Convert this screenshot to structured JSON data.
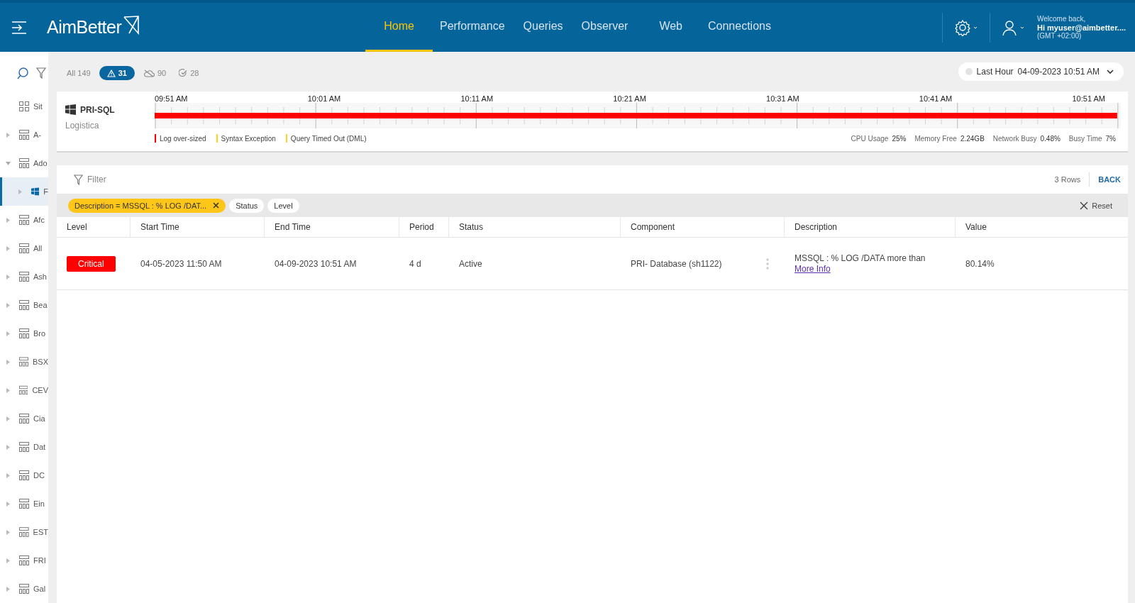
{
  "header": {
    "logo": "AimBetter",
    "nav": [
      {
        "label": "Home",
        "selected": true
      },
      {
        "label": "Performance",
        "selected": false
      },
      {
        "label": "Queries",
        "selected": false
      },
      {
        "label": "Observer",
        "selected": false
      },
      {
        "label": "Web",
        "selected": false
      },
      {
        "label": "Connections",
        "selected": false
      }
    ],
    "user": {
      "greeting": "Welcome back,",
      "name": "Hi myuser@aimbetter....",
      "timezone": "(GMT +02:00)"
    }
  },
  "sidebar": {
    "items": [
      {
        "kind": "overview",
        "label": "Sit",
        "selected": false
      },
      {
        "kind": "group",
        "label": "A-",
        "expanded": false,
        "selected": false
      },
      {
        "kind": "group",
        "label": "Ado",
        "expanded": true,
        "selected": false,
        "children": [
          {
            "kind": "server",
            "label": "F",
            "expanded": false,
            "selected": true
          }
        ]
      },
      {
        "kind": "group",
        "label": "Afc",
        "expanded": false,
        "selected": false
      },
      {
        "kind": "group",
        "label": "All",
        "expanded": false,
        "selected": false
      },
      {
        "kind": "group",
        "label": "Ash",
        "expanded": false,
        "selected": false
      },
      {
        "kind": "group",
        "label": "Bea",
        "expanded": false,
        "selected": false
      },
      {
        "kind": "group",
        "label": "Bro",
        "expanded": false,
        "selected": false
      },
      {
        "kind": "group",
        "label": "BSX",
        "expanded": false,
        "selected": false
      },
      {
        "kind": "group",
        "label": "CEV",
        "expanded": false,
        "selected": false
      },
      {
        "kind": "group",
        "label": "Cia",
        "expanded": false,
        "selected": false
      },
      {
        "kind": "group",
        "label": "Dat",
        "expanded": false,
        "selected": false
      },
      {
        "kind": "group",
        "label": "DC",
        "expanded": false,
        "selected": false
      },
      {
        "kind": "group",
        "label": "Ein",
        "expanded": false,
        "selected": false
      },
      {
        "kind": "group",
        "label": "EST",
        "expanded": false,
        "selected": false
      },
      {
        "kind": "group",
        "label": "FRI",
        "expanded": false,
        "selected": false
      },
      {
        "kind": "group",
        "label": "Gal",
        "expanded": false,
        "selected": false
      }
    ]
  },
  "status_filters": [
    {
      "kind": "all",
      "label": "All 149",
      "selected": false
    },
    {
      "kind": "alert",
      "label": "31",
      "selected": true
    },
    {
      "kind": "cloud",
      "label": "90",
      "selected": false
    },
    {
      "kind": "check",
      "label": "28",
      "selected": false
    }
  ],
  "time_range": {
    "period": "Last Hour",
    "date": "04-09-2023 10:51 AM"
  },
  "timeline": {
    "server": "PRI-SQL",
    "customer": "Logistica",
    "times": [
      "09:51 AM",
      "10:01 AM",
      "10:11 AM",
      "10:21 AM",
      "10:31 AM",
      "10:41 AM",
      "10:51 AM"
    ],
    "legend": [
      {
        "label": "Log over-sized",
        "color": "#ff0000"
      },
      {
        "label": "Syntax Exception",
        "color": "#ffd21f"
      },
      {
        "label": "Query Timed Out (DML)",
        "color": "#ffd21f"
      }
    ],
    "stats": [
      {
        "label": "CPU Usage",
        "value": "25%"
      },
      {
        "label": "Memory Free",
        "value": "2.24GB"
      },
      {
        "label": "Network Busy",
        "value": "0.48%"
      },
      {
        "label": "Busy Time",
        "value": "7%"
      }
    ]
  },
  "panel": {
    "filter_label": "Filter",
    "rows": "3 Rows",
    "back": "BACK",
    "reset": "Reset",
    "chips": [
      {
        "label": "Description = MSSQL : % LOG /DAT...",
        "active": true
      },
      {
        "label": "Status",
        "active": false
      },
      {
        "label": "Level",
        "active": false
      }
    ]
  },
  "table": {
    "columns": [
      "Level",
      "Start Time",
      "End Time",
      "Period",
      "Status",
      "Component",
      "Description",
      "Value"
    ],
    "rows": [
      {
        "level": "Critical",
        "start": "04-05-2023 11:50 AM",
        "end": "04-09-2023 10:51 AM",
        "period": "4 d",
        "status": "Active",
        "component": "PRI- Database (sh1122)",
        "description": "MSSQL : % LOG /DATA more than",
        "link": "More Info",
        "value": "80.14%"
      }
    ]
  }
}
